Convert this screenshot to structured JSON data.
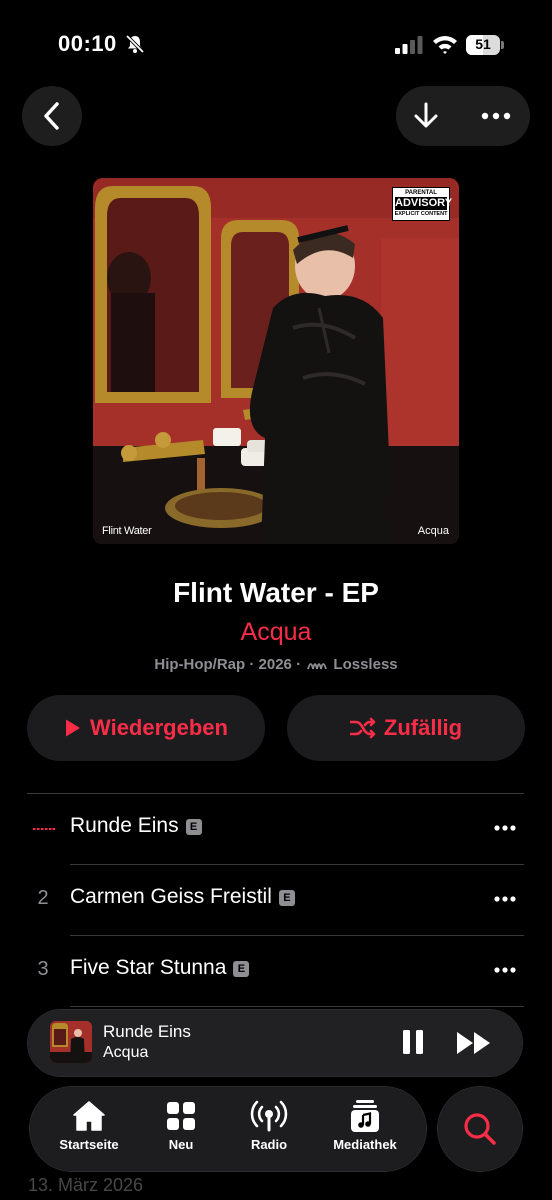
{
  "status_bar": {
    "time": "00:10",
    "battery": "51",
    "battery_level": 0.51,
    "icons": [
      "bell-slash-icon",
      "signal-icon",
      "wifi-icon",
      "battery-icon"
    ]
  },
  "nav": {
    "icons": [
      "chevron-left-icon",
      "download-icon",
      "ellipsis-icon"
    ]
  },
  "artwork": {
    "title_text": "Flint Water",
    "artist_text": "Acqua",
    "advisory": {
      "line1": "PARENTAL",
      "line2": "ADVISORY",
      "line3": "EXPLICIT CONTENT"
    }
  },
  "album": {
    "title": "Flint Water - EP",
    "artist": "Acqua",
    "genre": "Hip-Hop/Rap",
    "year": "2026",
    "sep": "·",
    "quality": "Lossless"
  },
  "buttons": {
    "play": "Wiedergeben",
    "shuffle": "Zufällig"
  },
  "tracks": [
    {
      "number": "",
      "title": "Runde Eins",
      "explicit": "E",
      "playing": true
    },
    {
      "number": "2",
      "title": "Carmen Geiss Freistil",
      "explicit": "E",
      "playing": false
    },
    {
      "number": "3",
      "title": "Five Star Stunna",
      "explicit": "E",
      "playing": false
    }
  ],
  "mini_player": {
    "title": "Runde Eins",
    "artist": "Acqua",
    "icons": [
      "pause-icon",
      "forward-icon"
    ]
  },
  "tabbar": {
    "tabs": [
      {
        "label": "Startseite",
        "icon": "house-icon"
      },
      {
        "label": "Neu",
        "icon": "grid-icon"
      },
      {
        "label": "Radio",
        "icon": "radio-icon"
      },
      {
        "label": "Mediathek",
        "icon": "library-icon"
      }
    ],
    "search_icon": "search-icon"
  },
  "footer": {
    "release_date": "13. März 2026"
  },
  "colors": {
    "accent": "#fa2d48",
    "background": "#000000",
    "pill": "#1c1c1e",
    "secondary_text": "#8e8e93"
  }
}
